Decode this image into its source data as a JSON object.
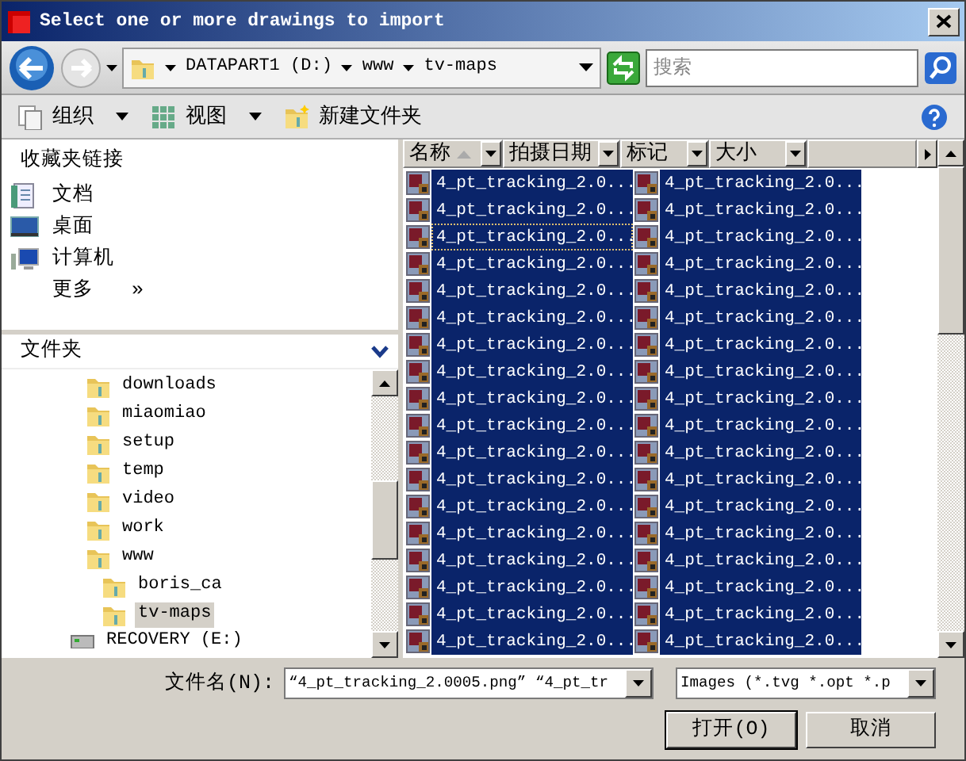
{
  "window": {
    "title": "Select one or more drawings to import"
  },
  "address": {
    "path": [
      {
        "label": "DATAPART1 (D:)"
      },
      {
        "label": "www"
      },
      {
        "label": "tv-maps"
      }
    ]
  },
  "search": {
    "placeholder": "搜索"
  },
  "toolbar": [
    {
      "label": "组织",
      "kind": "organize"
    },
    {
      "label": "视图",
      "kind": "views"
    },
    {
      "label": "新建文件夹",
      "kind": "newfolder"
    }
  ],
  "favorites": {
    "title": "收藏夹链接",
    "items": [
      {
        "label": "文档",
        "kind": "documents"
      },
      {
        "label": "桌面",
        "kind": "desktop"
      },
      {
        "label": "计算机",
        "kind": "computer"
      },
      {
        "label": "更多",
        "kind": "more",
        "glyph": "»"
      }
    ]
  },
  "folders": {
    "title": "文件夹",
    "items": [
      {
        "label": "downloads",
        "selected": false
      },
      {
        "label": "miaomiao",
        "selected": false
      },
      {
        "label": "setup",
        "selected": false
      },
      {
        "label": "temp",
        "selected": false
      },
      {
        "label": "video",
        "selected": false
      },
      {
        "label": "work",
        "selected": false
      },
      {
        "label": "www",
        "selected": false,
        "children": [
          {
            "label": "boris_ca",
            "selected": false
          },
          {
            "label": "tv-maps",
            "selected": true
          }
        ]
      }
    ],
    "drive": {
      "label": "RECOVERY (E:)"
    }
  },
  "columns": [
    {
      "label": "名称",
      "sorted": true
    },
    {
      "label": "拍摄日期",
      "sorted": false
    },
    {
      "label": "标记",
      "sorted": false
    },
    {
      "label": "大小",
      "sorted": false
    }
  ],
  "files": [
    {
      "name": "4_pt_tracking_2.0...",
      "selected": true,
      "focused": false
    },
    {
      "name": "4_pt_tracking_2.0...",
      "selected": true,
      "focused": false
    },
    {
      "name": "4_pt_tracking_2.0...",
      "selected": true,
      "focused": true
    },
    {
      "name": "4_pt_tracking_2.0...",
      "selected": true,
      "focused": false
    },
    {
      "name": "4_pt_tracking_2.0...",
      "selected": true,
      "focused": false
    },
    {
      "name": "4_pt_tracking_2.0...",
      "selected": true,
      "focused": false
    },
    {
      "name": "4_pt_tracking_2.0...",
      "selected": true,
      "focused": false
    },
    {
      "name": "4_pt_tracking_2.0...",
      "selected": true,
      "focused": false
    },
    {
      "name": "4_pt_tracking_2.0...",
      "selected": true,
      "focused": false
    },
    {
      "name": "4_pt_tracking_2.0...",
      "selected": true,
      "focused": false
    },
    {
      "name": "4_pt_tracking_2.0...",
      "selected": true,
      "focused": false
    },
    {
      "name": "4_pt_tracking_2.0...",
      "selected": true,
      "focused": false
    },
    {
      "name": "4_pt_tracking_2.0...",
      "selected": true,
      "focused": false
    },
    {
      "name": "4_pt_tracking_2.0...",
      "selected": true,
      "focused": false
    },
    {
      "name": "4_pt_tracking_2.0...",
      "selected": true,
      "focused": false
    },
    {
      "name": "4_pt_tracking_2.0...",
      "selected": true,
      "focused": false
    },
    {
      "name": "4_pt_tracking_2.0...",
      "selected": true,
      "focused": false
    },
    {
      "name": "4_pt_tracking_2.0...",
      "selected": true,
      "focused": false
    },
    {
      "name": "4_pt_tracking_2.0...",
      "selected": true,
      "focused": false
    },
    {
      "name": "4_pt_tracking_2.0...",
      "selected": true,
      "focused": false
    },
    {
      "name": "4_pt_tracking_2.0...",
      "selected": true,
      "focused": false
    },
    {
      "name": "4_pt_tracking_2.0...",
      "selected": true,
      "focused": false
    },
    {
      "name": "4_pt_tracking_2.0...",
      "selected": true,
      "focused": false
    },
    {
      "name": "4_pt_tracking_2.0...",
      "selected": true,
      "focused": false
    },
    {
      "name": "4_pt_tracking_2.0...",
      "selected": true,
      "focused": false
    },
    {
      "name": "4_pt_tracking_2.0...",
      "selected": true,
      "focused": false
    },
    {
      "name": "4_pt_tracking_2.0...",
      "selected": true,
      "focused": false
    },
    {
      "name": "4_pt_tracking_2.0...",
      "selected": true,
      "focused": false
    },
    {
      "name": "4_pt_tracking_2.0...",
      "selected": true,
      "focused": false
    },
    {
      "name": "4_pt_tracking_2.0...",
      "selected": true,
      "focused": false
    },
    {
      "name": "4_pt_tracking_2.0...",
      "selected": true,
      "focused": false
    },
    {
      "name": "4_pt_tracking_2.0...",
      "selected": true,
      "focused": false
    },
    {
      "name": "4_pt_tracking_2.0...",
      "selected": true,
      "focused": false
    },
    {
      "name": "4_pt_tracking_2.0...",
      "selected": true,
      "focused": false
    },
    {
      "name": "4_pt_tracking_2.0...",
      "selected": true,
      "focused": false
    },
    {
      "name": "4_pt_tracking_2.0...",
      "selected": true,
      "focused": false
    }
  ],
  "filename": {
    "label": "文件名(N):",
    "value": "“4_pt_tracking_2.0005.png” “4_pt_tr"
  },
  "filter": {
    "value": "Images (*.tvg *.opt *.p"
  },
  "buttons": [
    {
      "label": "打开(O)",
      "default": true
    },
    {
      "label": "取消",
      "default": false
    }
  ]
}
